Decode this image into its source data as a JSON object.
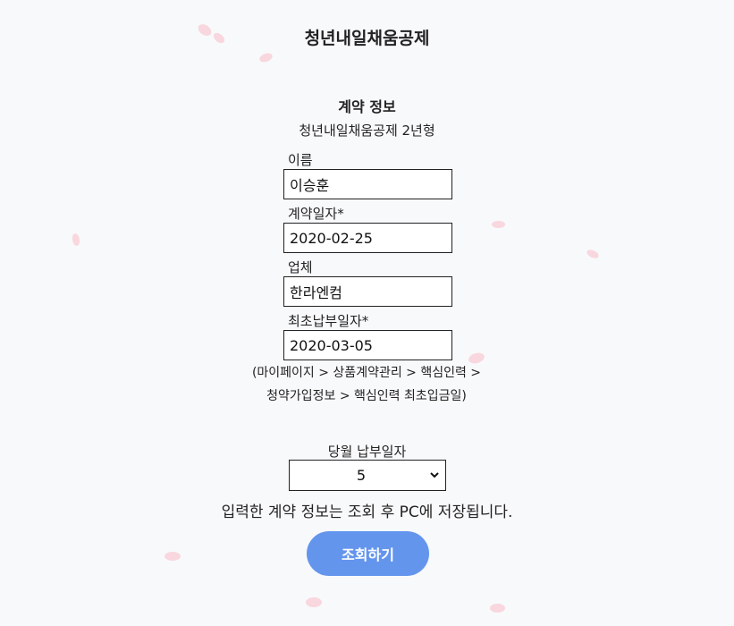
{
  "app": {
    "title": "청년내일채움공제"
  },
  "contract": {
    "section_title": "계약 정보",
    "product": "청년내일채움공제 2년형"
  },
  "form": {
    "name_label": "이름",
    "name_value": "이승훈",
    "contract_date_label": "계약일자*",
    "contract_date_value": "2020-02-25",
    "company_label": "업체",
    "company_value": "한라엔컴",
    "first_payment_label": "최초납부일자*",
    "first_payment_value": "2020-03-05",
    "hint_line1": "(마이페이지 > 상품계약관리 > 핵심인력 >",
    "hint_line2": "청약가입정보 > 핵심인력 최초입금일)",
    "payment_day_label": "당월 납부일자",
    "payment_day_value": "5"
  },
  "notice": "입력한 계약 정보는 조회 후 PC에 저장됩니다.",
  "actions": {
    "submit_label": "조회하기"
  },
  "colors": {
    "background": "#f8f9fb",
    "button": "#6495ed",
    "petal": "#f8d3dc"
  },
  "icons": {
    "select_chevron": "chevron-down-icon",
    "decoration": "cherry-blossom-petal"
  }
}
